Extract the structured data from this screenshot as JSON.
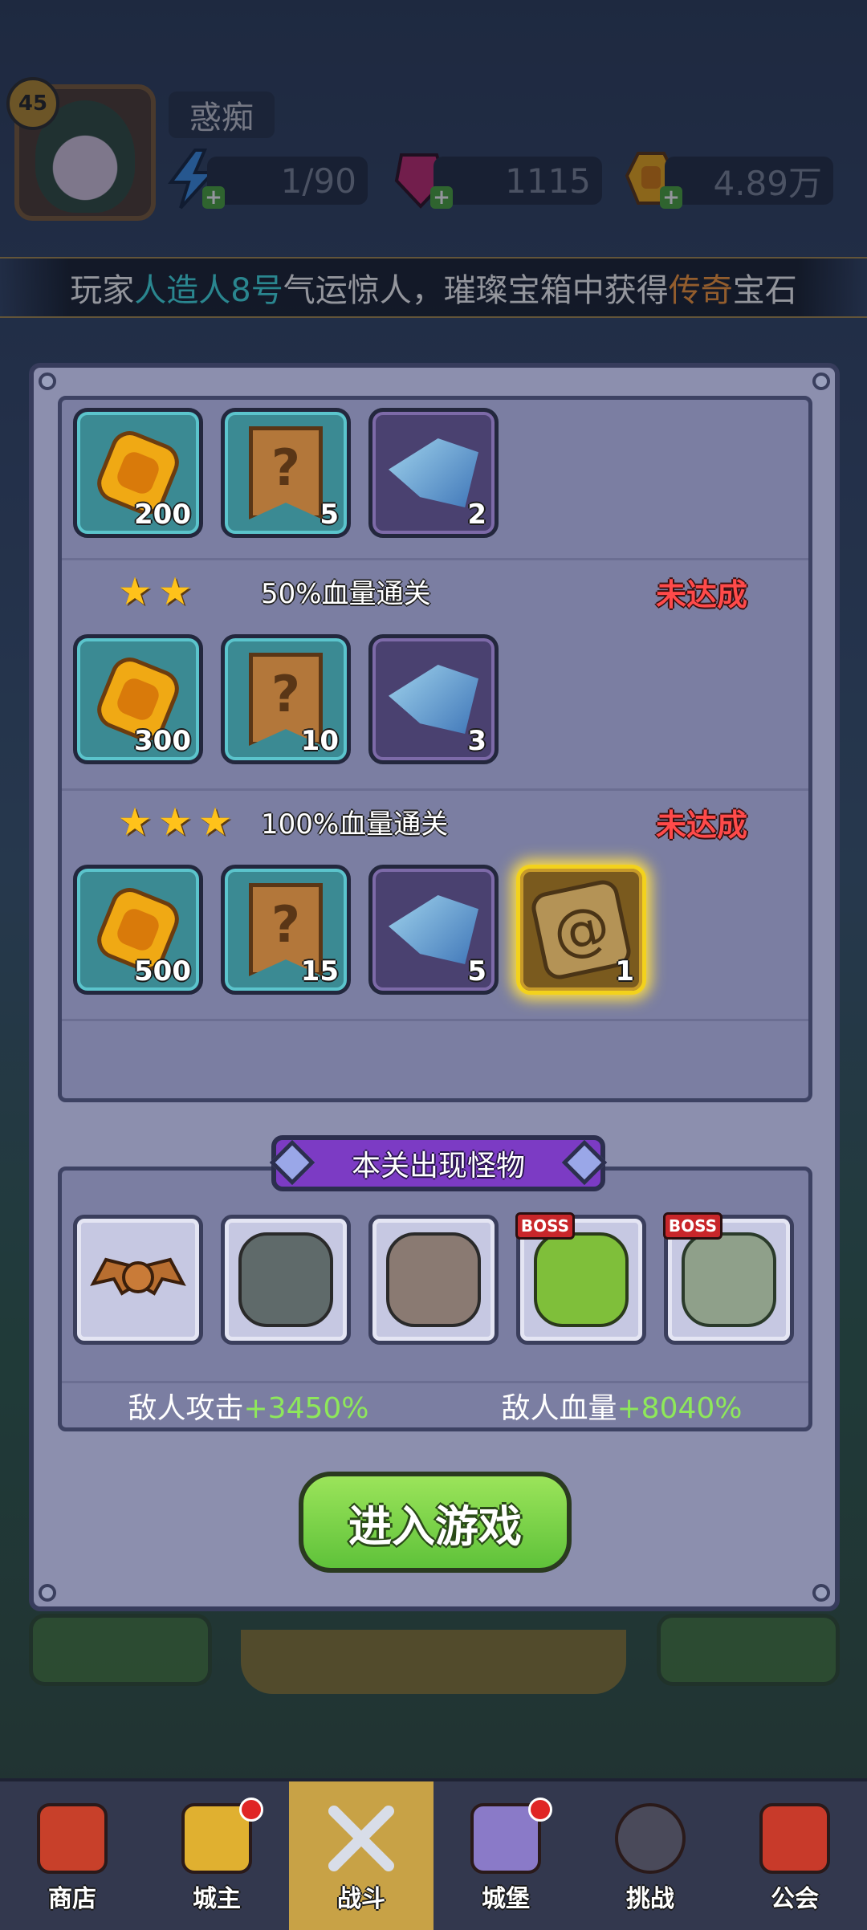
{
  "player": {
    "level": "45",
    "name": "惑痴",
    "energy": "1/90",
    "gems": "1115",
    "gold": "4.89万"
  },
  "ticker": {
    "prefix": "玩家",
    "player_name": "人造人8号",
    "middle": "气运惊人，璀璨宝箱中获得",
    "rarity": "传奇",
    "suffix": "宝石"
  },
  "rewards": {
    "tier1": {
      "items": [
        {
          "icon": "gold-coin-icon",
          "count": "200"
        },
        {
          "icon": "mystery-scroll-icon",
          "count": "5"
        },
        {
          "icon": "crystal-icon",
          "count": "2"
        }
      ]
    },
    "tier2": {
      "stars": 2,
      "label": "50%血量通关",
      "status": "未达成",
      "items": [
        {
          "icon": "gold-coin-icon",
          "count": "300"
        },
        {
          "icon": "mystery-scroll-icon",
          "count": "10"
        },
        {
          "icon": "crystal-icon",
          "count": "3"
        }
      ]
    },
    "tier3": {
      "stars": 3,
      "label": "100%血量通关",
      "status": "未达成",
      "items": [
        {
          "icon": "gold-coin-icon",
          "count": "500"
        },
        {
          "icon": "mystery-scroll-icon",
          "count": "15"
        },
        {
          "icon": "crystal-icon",
          "count": "5"
        },
        {
          "icon": "rune-stone-icon",
          "count": "1"
        }
      ]
    }
  },
  "monsters": {
    "title": "本关出现怪物",
    "boss_tag": "BOSS",
    "list": [
      {
        "icon": "bat-monster-icon",
        "boss": false
      },
      {
        "icon": "armored-knight-icon",
        "boss": false
      },
      {
        "icon": "horned-warrior-icon",
        "boss": false
      },
      {
        "icon": "green-dragon-icon",
        "boss": true
      },
      {
        "icon": "stone-golem-icon",
        "boss": true
      }
    ],
    "enemy_attack_label": "敌人攻击",
    "enemy_attack_value": "+3450%",
    "enemy_hp_label": "敌人血量",
    "enemy_hp_value": "+8040%"
  },
  "enter_button": "进入游戏",
  "nav": [
    {
      "label": "商店",
      "icon": "shop-icon"
    },
    {
      "label": "城主",
      "icon": "crown-icon"
    },
    {
      "label": "战斗",
      "icon": "crossed-swords-icon"
    },
    {
      "label": "城堡",
      "icon": "castle-icon"
    },
    {
      "label": "挑战",
      "icon": "demon-mask-icon"
    },
    {
      "label": "公会",
      "icon": "guild-banner-icon"
    }
  ],
  "colors": {
    "accent_green": "#8ee85a",
    "status_red": "#ff4a4a",
    "ticker_cyan": "#41e3e8",
    "ticker_orange": "#ff9a36"
  }
}
